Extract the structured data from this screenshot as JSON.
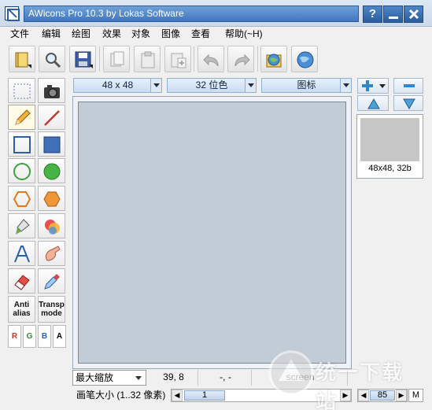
{
  "window": {
    "title": "AWicons Pro 10.3 by Lokas Software",
    "help_button": "?",
    "minimize_button": "",
    "close_button": "",
    "title_color": "#3f77c1"
  },
  "menu": {
    "items": [
      "文件",
      "编辑",
      "绘图",
      "效果",
      "对象",
      "图像",
      "查看",
      "帮助(~H)"
    ]
  },
  "toolbar": {
    "buttons": [
      "folder-icon",
      "magnifier-icon",
      "save-icon",
      "pages-icon",
      "clipboard-icon",
      "paste-icon",
      "undo-icon",
      "redo-icon",
      "globe-folder-icon",
      "globe-icon"
    ]
  },
  "tools": {
    "antialias_label_1": "Anti",
    "antialias_label_2": "alias",
    "transp_label_1": "Transp",
    "transp_label_2": "mode",
    "channels": [
      "R",
      "G",
      "B",
      "A"
    ]
  },
  "options": {
    "size": "48 x 48",
    "color_depth": "32 位色",
    "type": "图标"
  },
  "preview": {
    "label": "48x48, 32b"
  },
  "status": {
    "zoom": "最大缩放",
    "coords": "39, 8",
    "dash": "-, -",
    "screen": "screen"
  },
  "brush": {
    "label": "画笔大小 (1..32 像素)",
    "value": "1",
    "zoom_value": "85",
    "m_label": "M"
  },
  "watermark": {
    "text": "统一下载站"
  }
}
